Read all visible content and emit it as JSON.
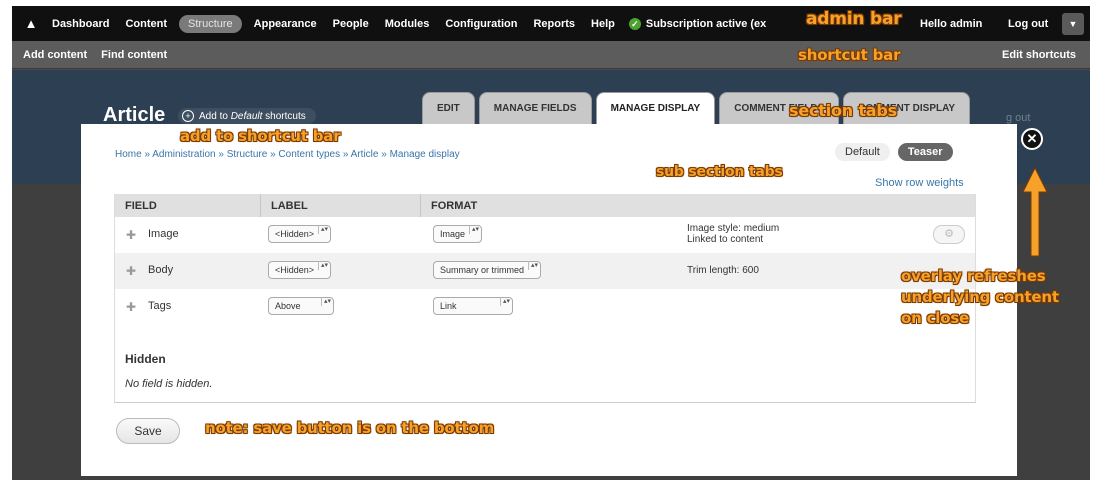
{
  "admin_bar": {
    "items": [
      "Dashboard",
      "Content",
      "Structure",
      "Appearance",
      "People",
      "Modules",
      "Configuration",
      "Reports",
      "Help"
    ],
    "active_item": "Structure",
    "subscription": "Subscription active (ex",
    "greeting": "Hello admin",
    "logout": "Log out"
  },
  "shortcut_bar": {
    "items": [
      "Add content",
      "Find content"
    ],
    "edit": "Edit shortcuts"
  },
  "page": {
    "title": "Article",
    "add_shortcut_prefix": "Add to ",
    "add_shortcut_emph": "Default",
    "add_shortcut_suffix": " shortcuts",
    "logout_ghost": "g out",
    "tabs": [
      {
        "label": "EDIT",
        "active": false
      },
      {
        "label": "MANAGE FIELDS",
        "active": false
      },
      {
        "label": "MANAGE DISPLAY",
        "active": true
      },
      {
        "label": "COMMENT FIELDS",
        "active": false
      },
      {
        "label": "COMMENT DISPLAY",
        "active": false
      }
    ]
  },
  "dialog": {
    "breadcrumb": "Home » Administration » Structure » Content types » Article » Manage display",
    "sub_tabs": [
      {
        "label": "Default",
        "active": false
      },
      {
        "label": "Teaser",
        "active": true
      }
    ],
    "row_weights": "Show row weights",
    "table": {
      "headers": [
        "FIELD",
        "LABEL",
        "FORMAT"
      ],
      "rows": [
        {
          "field": "Image",
          "label": "<Hidden>",
          "format": "Image",
          "summary_1": "Image style: medium",
          "summary_2": "Linked to content"
        },
        {
          "field": "Body",
          "label": "<Hidden>",
          "format": "Summary or trimmed",
          "summary_1": "Trim length: 600",
          "summary_2": ""
        },
        {
          "field": "Tags",
          "label": "Above",
          "format": "Link",
          "summary_1": "",
          "summary_2": ""
        }
      ],
      "hidden_label": "Hidden",
      "hidden_note": "No field is hidden."
    },
    "save": "Save"
  },
  "annotations": {
    "admin_bar": "admin bar",
    "shortcut_bar": "shortcut bar",
    "section_tabs": "section tabs",
    "add_to_shortcut": "add to shortcut bar",
    "sub_section_tabs": "sub section tabs",
    "overlay_1": "overlay refreshes",
    "overlay_2": "underlying content",
    "overlay_3": "on close",
    "save_note": "note: save button is on the bottom"
  },
  "icons": [
    "home-icon",
    "check-circle-icon",
    "toggle-arrow-icon",
    "plus-circle-icon",
    "close-icon",
    "drag-handle-icon",
    "gear-icon",
    "select-arrows-icon",
    "arrow-up-icon"
  ],
  "colors": {
    "admin_bar": "#101010",
    "shortcut_bar": "#5c5c5c",
    "page_header": "#2d3f52",
    "annotation": "#f7a12b",
    "link": "#3a76a8"
  }
}
